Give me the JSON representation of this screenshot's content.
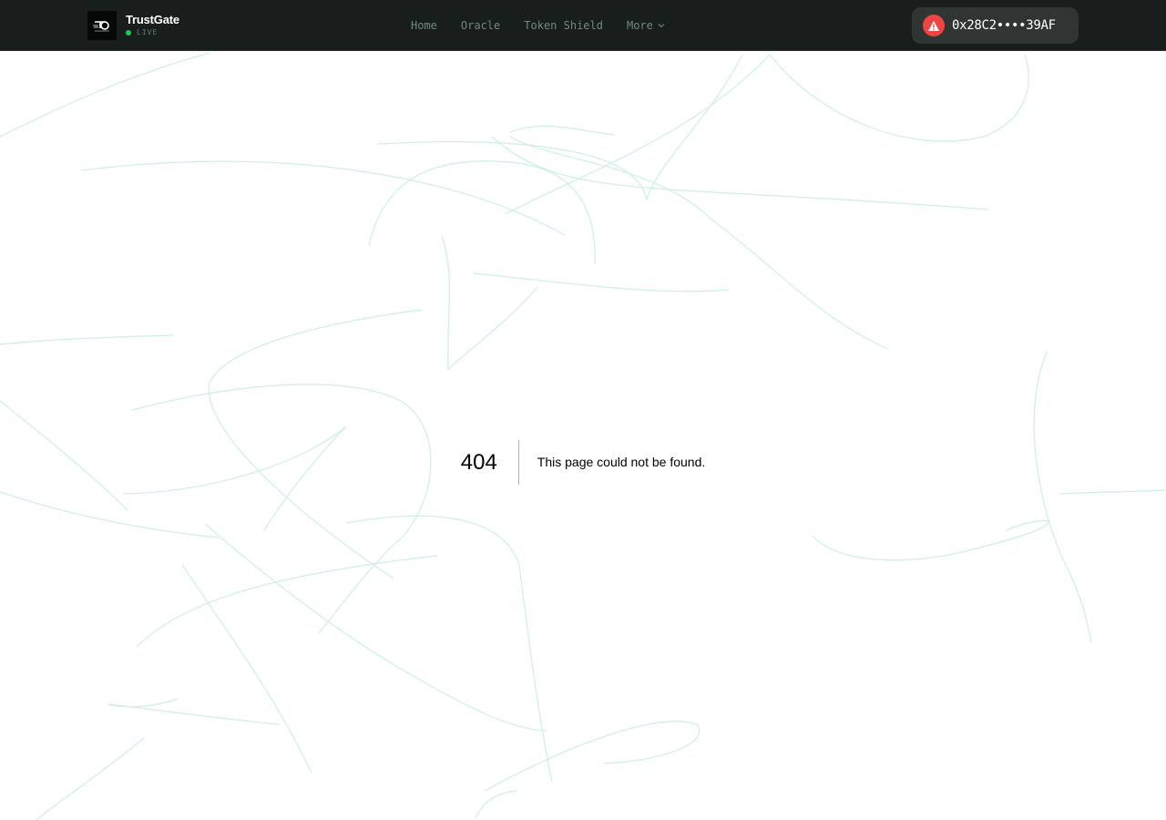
{
  "header": {
    "brand_name": "TrustGate",
    "status_label": "LIVE",
    "logo_icon": "trustgate-logo",
    "accent_color": "#22c55e",
    "background_color": "#181e1c"
  },
  "nav": {
    "items": [
      {
        "label": "Home"
      },
      {
        "label": "Oracle"
      },
      {
        "label": "Token Shield"
      },
      {
        "label": "More",
        "icon": "chevron-down-icon"
      }
    ]
  },
  "wallet": {
    "address": "0x28C2••••39AF",
    "status_icon": "warning-icon",
    "status_color": "#ef4444"
  },
  "error": {
    "code": "404",
    "message": "This page could not be found."
  },
  "background": {
    "stroke_color": "#cdeee6"
  }
}
